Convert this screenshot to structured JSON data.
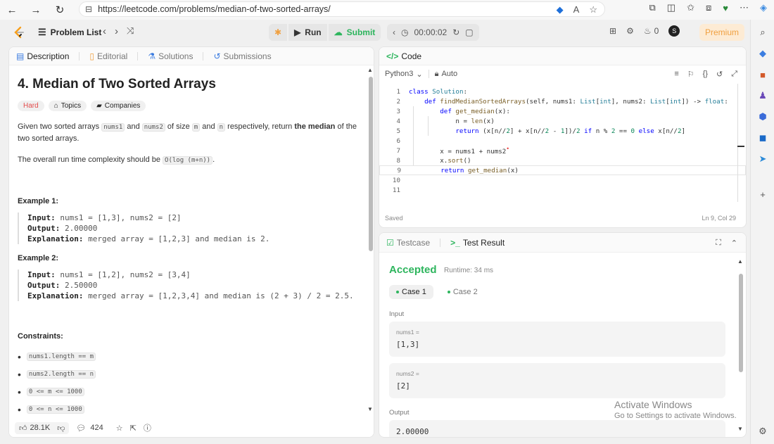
{
  "browser": {
    "url": "https://leetcode.com/problems/median-of-two-sorted-arrays/"
  },
  "topbar": {
    "problem_list": "Problem List",
    "run": "Run",
    "submit": "Submit",
    "timer": "00:00:02",
    "streak": "0",
    "avatar_letter": "S",
    "premium": "Premium"
  },
  "tabs": {
    "description": "Description",
    "editorial": "Editorial",
    "solutions": "Solutions",
    "submissions": "Submissions",
    "code": "Code",
    "testcase": "Testcase",
    "test_result": "Test Result"
  },
  "problem": {
    "title": "4. Median of Two Sorted Arrays",
    "difficulty": "Hard",
    "topics": "Topics",
    "companies": "Companies",
    "p1_a": "Given two sorted arrays ",
    "p1_nums1": "nums1",
    "p1_and": " and ",
    "p1_nums2": "nums2",
    "p1_of_size": " of size ",
    "p1_m": "m",
    "p1_and2": " and ",
    "p1_n": "n",
    "p1_resp": " respectively, return ",
    "p1_bold": "the median",
    "p1_end": " of the two sorted arrays.",
    "p2_a": "The overall run time complexity should be ",
    "p2_code": "O(log (m+n))",
    "p2_end": ".",
    "ex1_title": "Example 1:",
    "ex1_input_label": "Input:",
    "ex1_input": " nums1 = [1,3], nums2 = [2]",
    "ex1_output_label": "Output:",
    "ex1_output": " 2.00000",
    "ex1_expl_label": "Explanation:",
    "ex1_expl": " merged array = [1,2,3] and median is 2.",
    "ex2_title": "Example 2:",
    "ex2_input_label": "Input:",
    "ex2_input": " nums1 = [1,2], nums2 = [3,4]",
    "ex2_output_label": "Output:",
    "ex2_output": " 2.50000",
    "ex2_expl_label": "Explanation:",
    "ex2_expl": " merged array = [1,2,3,4] and median is (2 + 3) / 2 = 2.5.",
    "constraints_title": "Constraints:",
    "constraints": [
      "nums1.length == m",
      "nums2.length == n",
      "0 <= m <= 1000",
      "0 <= n <= 1000"
    ],
    "likes": "28.1K",
    "comments": "424"
  },
  "editor": {
    "language": "Python3",
    "mode": "Auto",
    "status_left": "Saved",
    "status_right": "Ln 9, Col 29"
  },
  "result": {
    "status": "Accepted",
    "runtime": "Runtime: 34 ms",
    "case1": "Case 1",
    "case2": "Case 2",
    "input_label": "Input",
    "var1_name": "nums1 =",
    "var1_value": "[1,3]",
    "var2_name": "nums2 =",
    "var2_value": "[2]",
    "output_label": "Output",
    "output_value": "2.00000"
  },
  "watermark": {
    "line1": "Activate Windows",
    "line2": "Go to Settings to activate Windows."
  }
}
